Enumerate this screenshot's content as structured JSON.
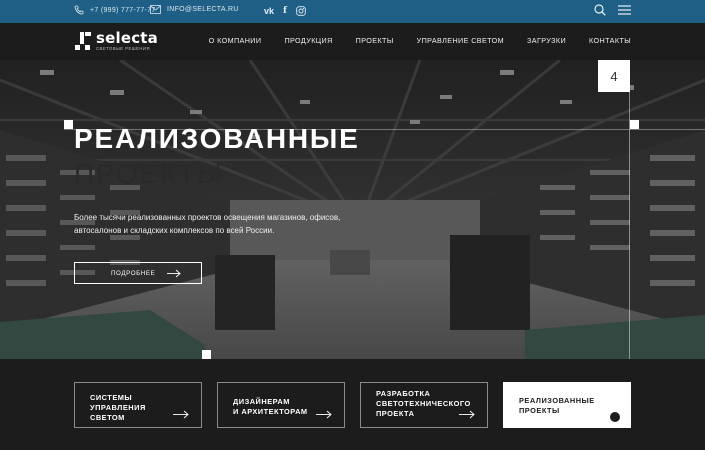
{
  "topbar": {
    "phone": "+7 (999) 777-77-77",
    "email": "INFO@SELECTA.RU",
    "social": [
      "vk-icon",
      "facebook-icon",
      "instagram-icon"
    ],
    "social_glyphs": [
      "vk",
      "f"
    ]
  },
  "logo": {
    "name": "selecta",
    "subtitle": "СВЕТОВЫЕ РЕШЕНИЯ"
  },
  "nav": {
    "items": [
      "О КОМПАНИИ",
      "ПРОДУКЦИЯ",
      "ПРОЕКТЫ",
      "УПРАВЛЕНИЕ СВЕТОМ",
      "ЗАГРУЗКИ",
      "КОНТАКТЫ"
    ]
  },
  "hero": {
    "counter": "4",
    "title_line1": "РЕАЛИЗОВАННЫЕ",
    "title_line2": "ПРОЕКТЫ",
    "description": "Более тысячи реализованных проектов освещения магазинов, офисов, автосалонов и складских комплексов по всей России.",
    "button_label": "ПОДРОБНЕЕ"
  },
  "cards": [
    {
      "label": "СИСТЕМЫ\nУПРАВЛЕНИЯ\nСВЕТОМ",
      "active": false
    },
    {
      "label": "ДИЗАЙНЕРАМ\nИ АРХИТЕКТОРАМ",
      "active": false
    },
    {
      "label": "РАЗРАБОТКА\nСВЕТОТЕХНИЧЕСКОГО\nПРОЕКТА",
      "active": false
    },
    {
      "label": "РЕАЛИЗОВАННЫЕ\nПРОЕКТЫ",
      "active": true
    }
  ],
  "colors": {
    "topbar": "#1f5f86",
    "dark": "#1c1c1c",
    "accent_text_dark": "#2a2a2a"
  }
}
